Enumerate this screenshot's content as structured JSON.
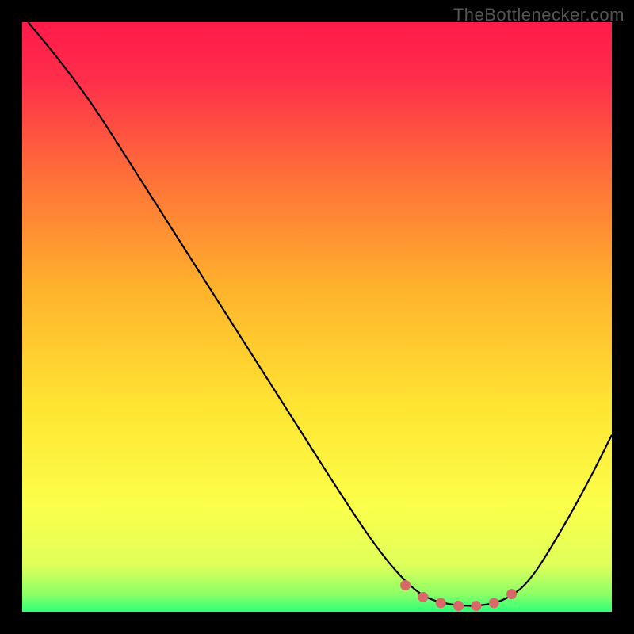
{
  "watermark": "TheBottlenecker.com",
  "chart_data": {
    "type": "line",
    "title": "",
    "xlabel": "",
    "ylabel": "",
    "xlim": [
      0,
      100
    ],
    "ylim": [
      0,
      100
    ],
    "gradient_stops": [
      {
        "pct": 0,
        "color": "#ff1a4a"
      },
      {
        "pct": 10,
        "color": "#ff2f4a"
      },
      {
        "pct": 25,
        "color": "#ff6b3a"
      },
      {
        "pct": 45,
        "color": "#ffb22c"
      },
      {
        "pct": 65,
        "color": "#ffe432"
      },
      {
        "pct": 82,
        "color": "#fbff4a"
      },
      {
        "pct": 92,
        "color": "#e0ff5a"
      },
      {
        "pct": 97,
        "color": "#8cff66"
      },
      {
        "pct": 100,
        "color": "#2eff7a"
      }
    ],
    "curve_points": [
      {
        "x": 1,
        "y": 100
      },
      {
        "x": 6,
        "y": 94
      },
      {
        "x": 12,
        "y": 86
      },
      {
        "x": 19,
        "y": 75
      },
      {
        "x": 26,
        "y": 64
      },
      {
        "x": 33,
        "y": 53
      },
      {
        "x": 40,
        "y": 42
      },
      {
        "x": 47,
        "y": 31
      },
      {
        "x": 54,
        "y": 20
      },
      {
        "x": 60,
        "y": 11
      },
      {
        "x": 65,
        "y": 5
      },
      {
        "x": 69,
        "y": 2
      },
      {
        "x": 74,
        "y": 1
      },
      {
        "x": 78,
        "y": 1
      },
      {
        "x": 82,
        "y": 2
      },
      {
        "x": 86,
        "y": 5
      },
      {
        "x": 91,
        "y": 13
      },
      {
        "x": 96,
        "y": 22
      },
      {
        "x": 100,
        "y": 30
      }
    ],
    "marker_points": [
      {
        "x": 65,
        "y": 4.5
      },
      {
        "x": 68,
        "y": 2.5
      },
      {
        "x": 71,
        "y": 1.5
      },
      {
        "x": 74,
        "y": 1
      },
      {
        "x": 77,
        "y": 1
      },
      {
        "x": 80,
        "y": 1.5
      },
      {
        "x": 83,
        "y": 3
      }
    ],
    "marker_color": "#d96868",
    "curve_color": "#000000"
  }
}
